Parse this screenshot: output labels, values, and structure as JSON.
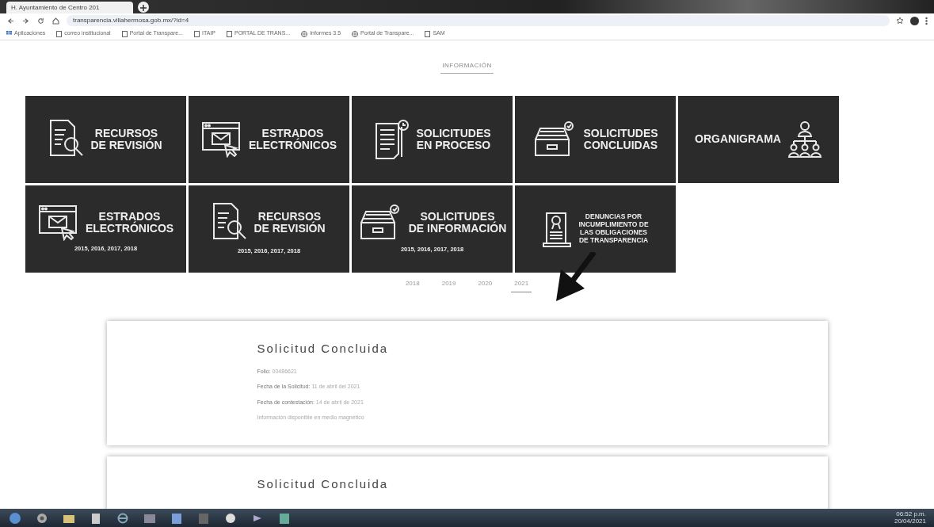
{
  "browser": {
    "tab_title": "H. Ayuntamiento de Centro 201",
    "url": "transparencia.villahermosa.gob.mx/?id=4",
    "bookmarks": [
      {
        "label": "Aplicaciones",
        "kind": "apps"
      },
      {
        "label": "correo institucional",
        "kind": "page"
      },
      {
        "label": "Portal de Transpare...",
        "kind": "page"
      },
      {
        "label": "ITAIP",
        "kind": "page"
      },
      {
        "label": "PORTAL DE TRANS...",
        "kind": "page"
      },
      {
        "label": "Informes 3.5",
        "kind": "globe"
      },
      {
        "label": "Portal de Transpare...",
        "kind": "globe"
      },
      {
        "label": "SAM",
        "kind": "page"
      }
    ]
  },
  "nav": [
    {
      "label": "INFORMACIÓN",
      "selected": true
    }
  ],
  "tiles": [
    {
      "lines": [
        "RECURSOS",
        "DE REVISIÓN"
      ],
      "kind": "document-search"
    },
    {
      "lines": [
        "ESTRADOS",
        "ELECTRÓNICOS"
      ],
      "kind": "browser-mail"
    },
    {
      "lines": [
        "SOLICITUDES",
        "EN PROCESO"
      ],
      "kind": "document-clock"
    },
    {
      "lines": [
        "SOLICITUDES",
        "CONCLUIDAS"
      ],
      "kind": "inbox-check"
    },
    {
      "lines": [
        "ORGANIGRAMA"
      ],
      "kind": "org-chart"
    },
    {
      "lines": [
        "ESTRADOS",
        "ELECTRÓNICOS"
      ],
      "kind": "browser-mail",
      "years": "2015, 2016, 2017, 2018"
    },
    {
      "lines": [
        "RECURSOS",
        "DE REVISIÓN"
      ],
      "kind": "document-search",
      "years": "2015, 2016, 2017, 2018"
    },
    {
      "lines": [
        "SOLICITUDES",
        "DE INFORMACIÓN"
      ],
      "kind": "inbox-check",
      "years": "2015, 2016, 2017, 2018"
    },
    {
      "lines": [
        "DENUNCIAS POR",
        "INCUMPLIMIENTO DE",
        "LAS OBLIGACIONES",
        "DE TRANSPARENCIA"
      ],
      "kind": "scroll"
    }
  ],
  "year_tabs": [
    {
      "label": "2018",
      "selected": false
    },
    {
      "label": "2019",
      "selected": false
    },
    {
      "label": "2020",
      "selected": false
    },
    {
      "label": "2021",
      "selected": true
    }
  ],
  "records": [
    {
      "title": "Solicitud Concluida",
      "fields": [
        {
          "label": "Folio:",
          "value": "00486621"
        },
        {
          "label": "Fecha de la Solicitud:",
          "value": "11 de abril del 2021"
        },
        {
          "label": "Fecha de contestación:",
          "value": "14 de abril de 2021"
        }
      ],
      "note": "Información disponible en medio magnético"
    },
    {
      "title": "Solicitud Concluida"
    }
  ],
  "taskbar": {
    "time": "06:52 p.m.",
    "date": "20/04/2021"
  }
}
